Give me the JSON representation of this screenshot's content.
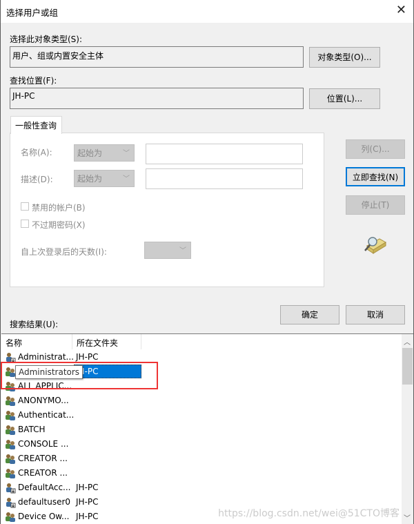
{
  "window": {
    "title": "选择用户或组",
    "close_icon": "close-icon"
  },
  "object_type": {
    "label": "选择此对象类型(S):",
    "value": "用户、组或内置安全主体",
    "button": "对象类型(O)..."
  },
  "location": {
    "label": "查找位置(F):",
    "value": "JH-PC",
    "button": "位置(L)..."
  },
  "query": {
    "tab": "一般性查询",
    "name_label": "名称(A):",
    "name_mode": "起始为",
    "name_value": "",
    "desc_label": "描述(D):",
    "desc_mode": "起始为",
    "desc_value": "",
    "disabled_accounts": "禁用的帐户(B)",
    "non_expiring_pw": "不过期密码(X)",
    "days_label": "自上次登录后的天数(I):",
    "days_value": ""
  },
  "side_buttons": {
    "columns": "列(C)...",
    "find_now": "立即查找(N)",
    "stop": "停止(T)"
  },
  "dialog_buttons": {
    "ok": "确定",
    "cancel": "取消"
  },
  "results": {
    "label": "搜索结果(U):",
    "columns": [
      "名称",
      "所在文件夹"
    ],
    "rows": [
      {
        "name": "Administrat...",
        "folder": "JH-PC",
        "icon": "user-icon"
      },
      {
        "name": "Administrators",
        "folder": "JH-PC",
        "icon": "group-icon",
        "selected": true
      },
      {
        "name": "ALL APPLIC...",
        "folder": "",
        "icon": "group-icon"
      },
      {
        "name": "ANONYMO...",
        "folder": "",
        "icon": "group-icon"
      },
      {
        "name": "Authenticat...",
        "folder": "",
        "icon": "group-icon"
      },
      {
        "name": "BATCH",
        "folder": "",
        "icon": "group-icon"
      },
      {
        "name": "CONSOLE ...",
        "folder": "",
        "icon": "group-icon"
      },
      {
        "name": "CREATOR ...",
        "folder": "",
        "icon": "group-icon"
      },
      {
        "name": "CREATOR ...",
        "folder": "",
        "icon": "group-icon"
      },
      {
        "name": "DefaultAcc...",
        "folder": "JH-PC",
        "icon": "user-icon"
      },
      {
        "name": "defaultuser0",
        "folder": "JH-PC",
        "icon": "user-icon"
      },
      {
        "name": "Device Ow...",
        "folder": "JH-PC",
        "icon": "group-icon"
      }
    ],
    "tooltip": "Administrators"
  },
  "watermark": "https://blog.csdn.net/wei@51CTO博客"
}
